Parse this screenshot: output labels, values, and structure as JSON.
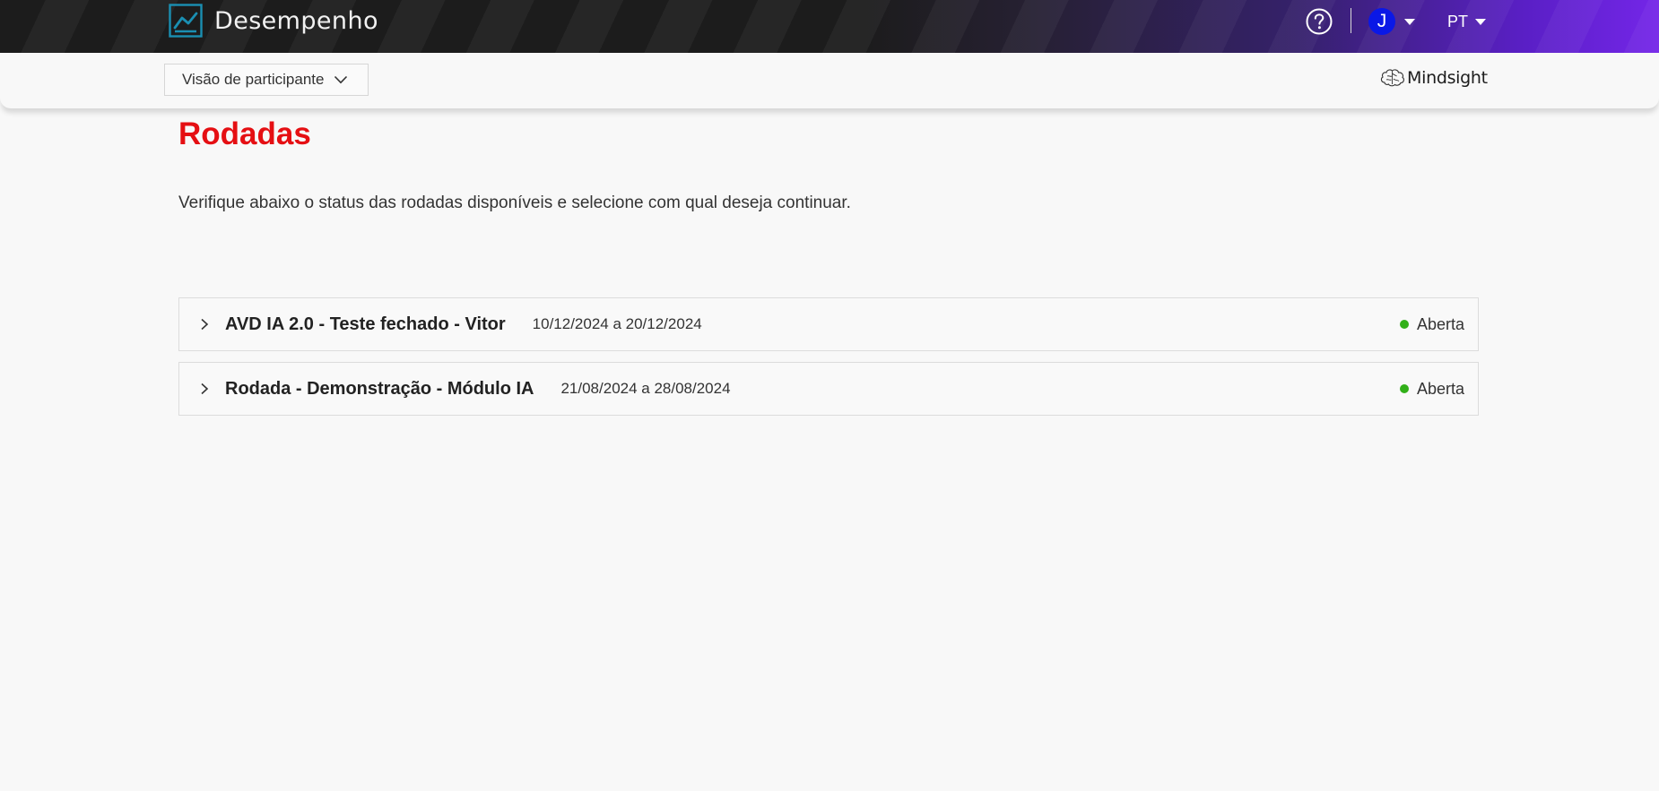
{
  "header": {
    "app_title": "Desempenho",
    "user_initial": "J",
    "language": "PT",
    "brand_icon": "chart-line-icon",
    "help_icon": "help-circle-icon"
  },
  "subheader": {
    "view_selector": "Visão de participante",
    "logo_text": "Mindsight"
  },
  "main": {
    "title": "Rodadas",
    "description": "Verifique abaixo o status das rodadas disponíveis e selecione com qual deseja continuar.",
    "rounds": [
      {
        "name": "AVD IA 2.0 - Teste fechado - Vitor",
        "dates": "10/12/2024 a 20/12/2024",
        "status": "Aberta"
      },
      {
        "name": "Rodada - Demonstração - Módulo IA",
        "dates": "21/08/2024 a 28/08/2024",
        "status": "Aberta"
      }
    ]
  },
  "colors": {
    "title_red": "#e50f13",
    "status_green": "#32b019",
    "avatar_blue": "#0a18e6",
    "brand_teal": "#1a8fb2",
    "header_purple": "#7426e8"
  }
}
